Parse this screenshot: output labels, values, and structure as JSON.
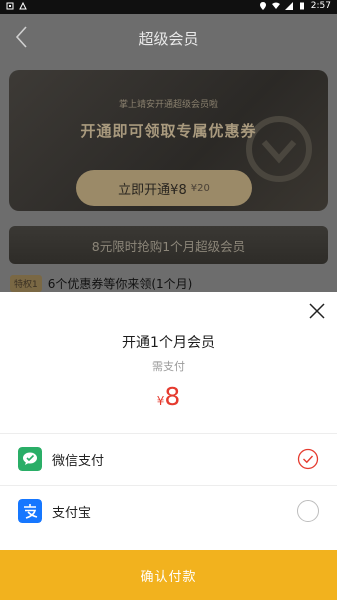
{
  "status_bar": {
    "time": "2:57"
  },
  "header": {
    "title": "超级会员"
  },
  "vip_card": {
    "subtitle": "掌上靖安开通超级会员啦",
    "headline": "开通即可领取专属优惠券",
    "button_label": "立即开通¥8",
    "button_price": "¥20"
  },
  "promo": {
    "text": "8元限时抢购1个月超级会员"
  },
  "perk": {
    "badge": "特权1",
    "text": "6个优惠券等你来领(1个月)"
  },
  "sheet": {
    "title": "开通1个月会员",
    "subtitle": "需支付",
    "currency": "¥",
    "amount": "8",
    "payment_methods": [
      {
        "label": "微信支付",
        "icon": "wechat-pay-icon",
        "selected": true
      },
      {
        "label": "支付宝",
        "icon": "alipay-icon",
        "selected": false
      }
    ],
    "confirm_label": "确认付款"
  },
  "colors": {
    "accent": "#f2b21e",
    "price": "#e53b2f",
    "wechat": "#2aae67",
    "alipay": "#1677ff"
  }
}
